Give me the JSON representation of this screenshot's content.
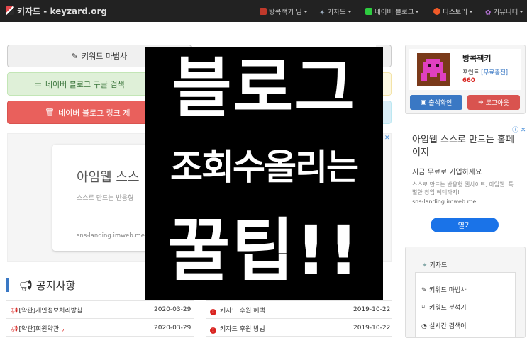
{
  "navbar": {
    "brand": "키자드 - keyzard.org",
    "user": "방콕잭키 님",
    "menu_keyzard": "키자드",
    "menu_naver_blog": "네이버 블로그",
    "menu_tistory": "티스토리",
    "menu_community": "커뮤니티"
  },
  "tools": {
    "magic_label": "키워드 마법사",
    "naver_label": "네이버 블로그 구글 검색",
    "delete_label": "네이버 블로그 링크 제"
  },
  "ad_main": {
    "title": "아임웹 스스",
    "subtitle": "스스로 만드는 반응형",
    "url": "sns-landing.imweb.me"
  },
  "overlay": {
    "line1": "블로그",
    "line2": "조회수올리는",
    "line3": "꿀팁!!"
  },
  "notice": {
    "title": "공지사항",
    "left": [
      {
        "label": "[약관]개인정보처리방침",
        "date": "2020-03-29",
        "badge": ""
      },
      {
        "label": "[약관]회원약관",
        "date": "2020-03-29",
        "badge": "2"
      }
    ],
    "right": [
      {
        "label": "키자드 후원 혜택",
        "date": "2019-10-22"
      },
      {
        "label": "키자드 후원 방법",
        "date": "2019-10-22"
      }
    ]
  },
  "profile": {
    "username": "방콕잭키",
    "points_label": "포인트",
    "charge_link": "[무료충전]",
    "points": "660",
    "checkin_label": "출석확인",
    "logout_label": "로그아웃"
  },
  "ad_right": {
    "title": "아임웹 스스로 만드는 홈페이지",
    "sub": "지금 무료로 가입하세요",
    "desc": "스스로 만드는 반응형 웹사이트, 아임웹. 특별한 창업 혜택까지!",
    "url": "sns-landing.imweb.me",
    "open_label": "열기"
  },
  "sidebar_menu": {
    "header": "키자드",
    "items": [
      "키워드 마법사",
      "키워드 분석기",
      "실시간 검색어"
    ]
  }
}
